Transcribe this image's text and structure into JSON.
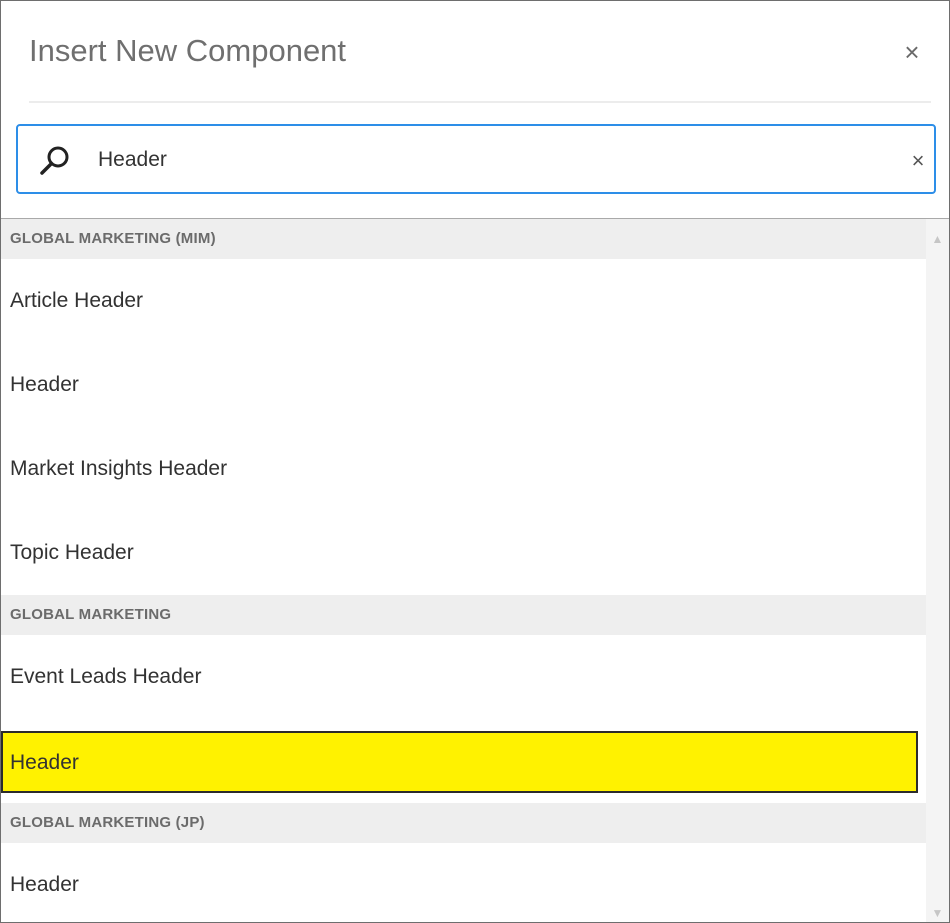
{
  "dialog": {
    "title": "Insert New Component",
    "close_glyph": "×"
  },
  "search": {
    "value": "Header",
    "clear_glyph": "×",
    "icon": "search-icon"
  },
  "groups": [
    {
      "label": "GLOBAL MARKETING (MIM)",
      "items": [
        "Article Header",
        "Header",
        "Market Insights Header",
        "Topic Header"
      ]
    },
    {
      "label": "GLOBAL MARKETING",
      "items": [
        "Event Leads Header",
        "Header"
      ]
    },
    {
      "label": "GLOBAL MARKETING (JP)",
      "items": [
        "Header"
      ]
    }
  ],
  "scrollbar": {
    "up_glyph": "▲",
    "down_glyph": "▼"
  },
  "colors": {
    "highlight": "#fff200",
    "focus_border": "#2d8ee8"
  }
}
